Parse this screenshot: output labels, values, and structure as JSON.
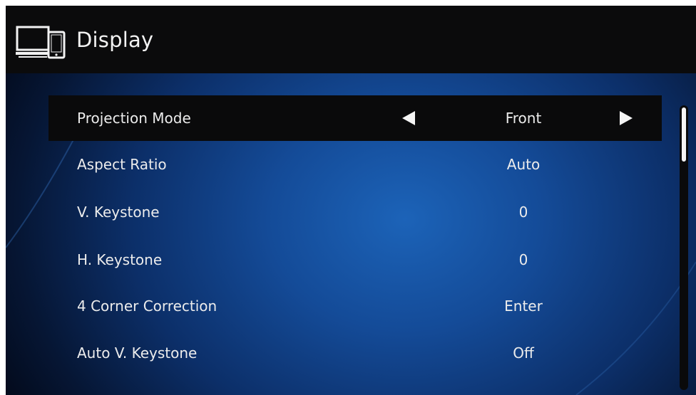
{
  "header": {
    "title": "Display",
    "icon": "display-devices-icon"
  },
  "menu": {
    "items": [
      {
        "label": "Projection Mode",
        "value": "Front",
        "selected": true
      },
      {
        "label": "Aspect Ratio",
        "value": "Auto",
        "selected": false
      },
      {
        "label": "V. Keystone",
        "value": "0",
        "selected": false
      },
      {
        "label": "H. Keystone",
        "value": "0",
        "selected": false
      },
      {
        "label": "4 Corner Correction",
        "value": "Enter",
        "selected": false
      },
      {
        "label": "Auto V. Keystone",
        "value": "Off",
        "selected": false
      }
    ]
  },
  "colors": {
    "background": "#0c2f69",
    "header": "#0b0b0c",
    "selected_row": "#0a0a0b",
    "text": "#ececec"
  }
}
